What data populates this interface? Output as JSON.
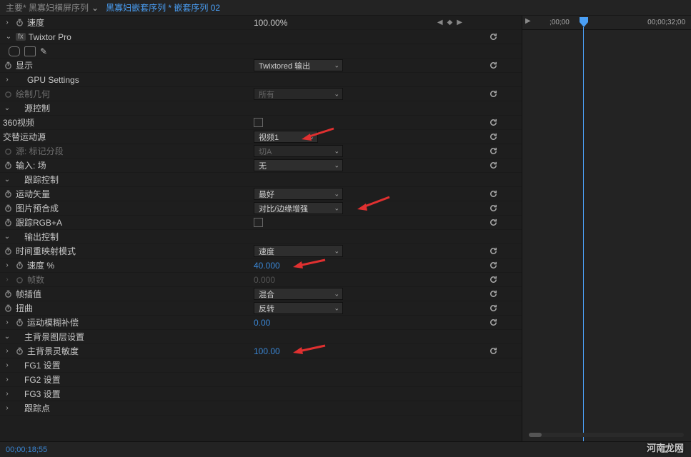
{
  "breadcrumb": {
    "prefix": "主要* 黑寡妇横屏序列",
    "active": "黑寡妇嵌套序列 * 嵌套序列 02"
  },
  "timeline": {
    "start": ";00;00",
    "end": "00;00;32;00"
  },
  "speedRow": {
    "label": "速度",
    "value": "100.00%"
  },
  "effect": {
    "name": "Twixtor Pro",
    "rows": {
      "display": {
        "label": "显示",
        "value": "Twixtored 输出"
      },
      "gpu": {
        "label": "GPU Settings"
      },
      "drawGeom": {
        "label": "绘制几何",
        "value": "所有"
      },
      "sourceCtrl": {
        "label": "源控制"
      },
      "video360": {
        "label": "360视频"
      },
      "altMotionSource": {
        "label": "交替运动源",
        "value": "视频1"
      },
      "srcMarkSeg": {
        "label": "源: 标记分段",
        "value": "切A"
      },
      "inputField": {
        "label": "输入: 场",
        "value": "无"
      },
      "trackCtrl": {
        "label": "跟踪控制"
      },
      "motionVector": {
        "label": "运动矢量",
        "value": "最好"
      },
      "imgPrep": {
        "label": "图片预合成",
        "value": "对比/边缘增强"
      },
      "trackRGBA": {
        "label": "跟踪RGB+A"
      },
      "outputCtrl": {
        "label": "输出控制"
      },
      "timeRemapMode": {
        "label": "时间重映射模式",
        "value": "速度"
      },
      "speedPct": {
        "label": "速度 %",
        "value": "40.000"
      },
      "frameCount": {
        "label": "帧数",
        "value": "0.000"
      },
      "frameInterp": {
        "label": "帧插值",
        "value": "混合"
      },
      "warp": {
        "label": "扭曲",
        "value": "反转"
      },
      "motionBlurComp": {
        "label": "运动模糊补偿",
        "value": "0.00"
      },
      "mainBgLayer": {
        "label": "主背景图层设置"
      },
      "mainBgSens": {
        "label": "主背景灵敏度",
        "value": "100.00"
      },
      "fg1": {
        "label": "FG1 设置"
      },
      "fg2": {
        "label": "FG2 设置"
      },
      "fg3": {
        "label": "FG3 设置"
      },
      "trackPoint": {
        "label": "跟踪点"
      }
    }
  },
  "footer": {
    "timecode": "00;00;18;55"
  },
  "watermark": "河南龙网"
}
